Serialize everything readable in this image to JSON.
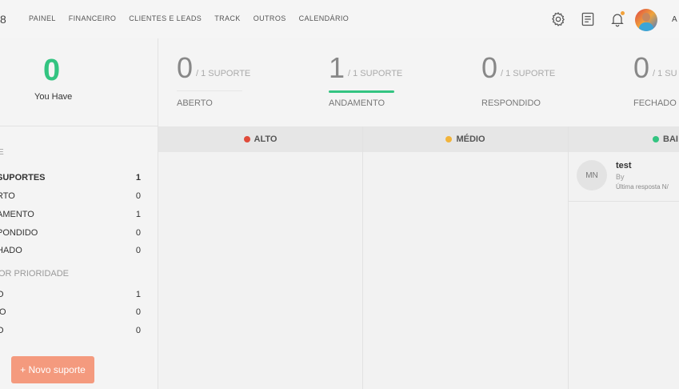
{
  "brand": "8",
  "nav": [
    "PAINEL",
    "FINANCEIRO",
    "CLIENTES E LEADS",
    "TRACK",
    "OUTROS",
    "CALENDÁRIO"
  ],
  "user": {
    "name": "A"
  },
  "summary": {
    "count": "0",
    "label": "You Have"
  },
  "filters": {
    "status_title": "E",
    "status": [
      {
        "label": "SUPORTES",
        "count": "1"
      },
      {
        "label": "RTO",
        "count": "0"
      },
      {
        "label": "AMENTO",
        "count": "1"
      },
      {
        "label": "PONDIDO",
        "count": "0"
      },
      {
        "label": "HADO",
        "count": "0"
      }
    ],
    "priority_title": "OR PRIORIDADE",
    "priority": [
      {
        "label": "O",
        "count": "1"
      },
      {
        "label": "IO",
        "count": "0"
      },
      {
        "label": "O",
        "count": "0"
      }
    ]
  },
  "new_button": "+ Novo suporte",
  "stats": [
    {
      "num": "0",
      "of": "/ 1 SUPORTE",
      "label": "ABERTO"
    },
    {
      "num": "1",
      "of": "/ 1 SUPORTE",
      "label": "ANDAMENTO"
    },
    {
      "num": "0",
      "of": "/ 1 SUPORTE",
      "label": "RESPONDIDO"
    },
    {
      "num": "0",
      "of": "/ 1 SU",
      "label": "FECHADO"
    }
  ],
  "columns": [
    {
      "title": "ALTO",
      "color": "#e04b3a"
    },
    {
      "title": "MÉDIO",
      "color": "#f2b43b"
    },
    {
      "title": "BAI",
      "color": "#33c481"
    }
  ],
  "card": {
    "initials": "MN",
    "title": "test",
    "by": "By",
    "last": "Última resposta N/"
  }
}
